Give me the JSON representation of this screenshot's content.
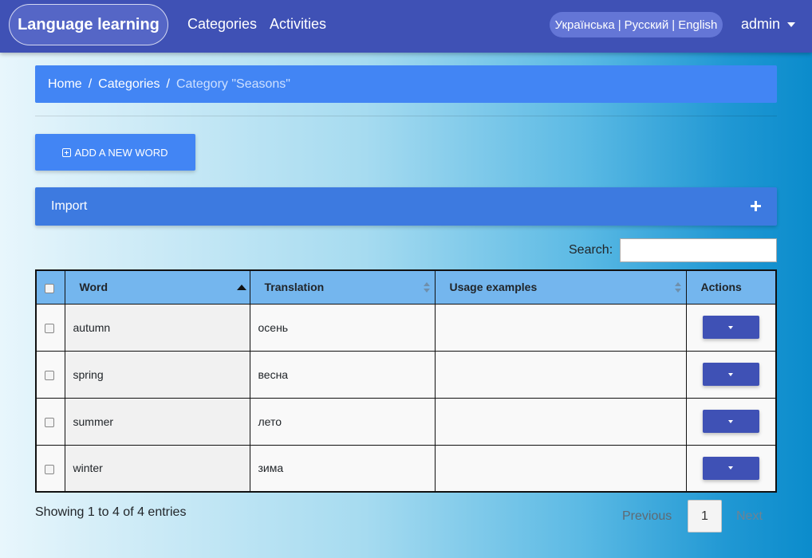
{
  "navbar": {
    "brand": "Language learning",
    "links": [
      "Categories",
      "Activities"
    ],
    "languages": [
      "Українська",
      "Русский",
      "English"
    ],
    "language_separator": "|",
    "user": "admin"
  },
  "breadcrumb": {
    "items": [
      "Home",
      "Categories"
    ],
    "separator": "/",
    "active": "Category \"Seasons\""
  },
  "actions": {
    "add_word": "ADD A NEW WORD",
    "import": "Import"
  },
  "search": {
    "label": "Search:",
    "value": ""
  },
  "table": {
    "columns": [
      "Word",
      "Translation",
      "Usage examples",
      "Actions"
    ],
    "rows": [
      {
        "word": "autumn",
        "translation": "осень",
        "usage": ""
      },
      {
        "word": "spring",
        "translation": "весна",
        "usage": ""
      },
      {
        "word": "summer",
        "translation": "лето",
        "usage": ""
      },
      {
        "word": "winter",
        "translation": "зима",
        "usage": ""
      }
    ]
  },
  "footer": {
    "info": "Showing 1 to 4 of 4 entries",
    "previous": "Previous",
    "current_page": "1",
    "next": "Next"
  },
  "colors": {
    "navbar": "#3f51b5",
    "primary": "#4285f4",
    "table_header": "#74b6ee",
    "action_button": "#3f51b5"
  }
}
